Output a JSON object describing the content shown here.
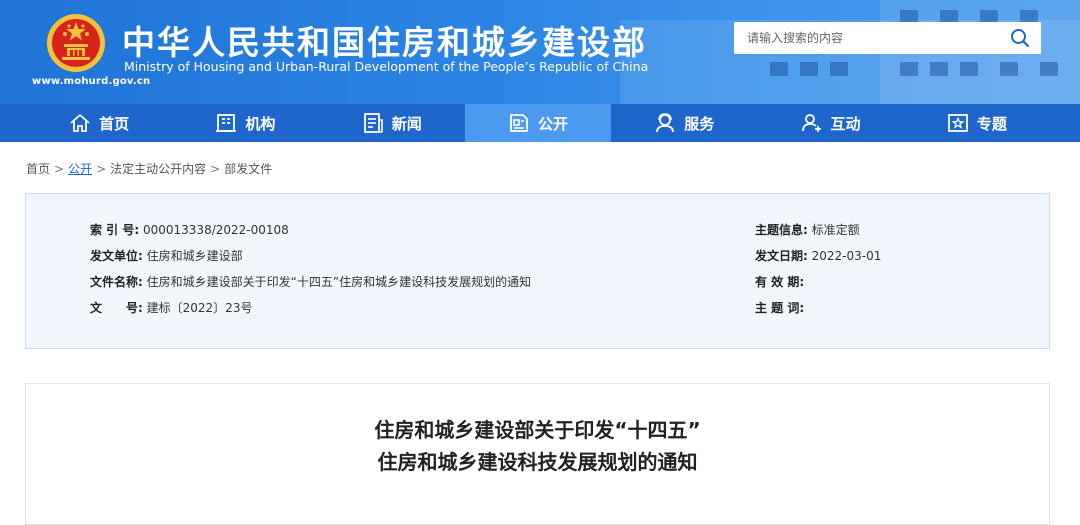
{
  "header": {
    "title": "中华人民共和国住房和城乡建设部",
    "subtitle": "Ministry of Housing and Urban-Rural Development of the People’s Republic of China",
    "domain": "www.mohurd.gov.cn",
    "emblem_icon": "national-emblem-icon"
  },
  "search": {
    "placeholder": "请输入搜索的内容",
    "icon": "search-icon"
  },
  "nav": {
    "items": [
      {
        "label": "首页",
        "icon": "home-icon"
      },
      {
        "label": "机构",
        "icon": "building-icon"
      },
      {
        "label": "新闻",
        "icon": "newspaper-icon"
      },
      {
        "label": "公开",
        "icon": "public-info-icon"
      },
      {
        "label": "服务",
        "icon": "service-icon"
      },
      {
        "label": "互动",
        "icon": "interaction-icon"
      },
      {
        "label": "专题",
        "icon": "topic-icon"
      }
    ],
    "active": "公开"
  },
  "breadcrumb": {
    "home": "首页",
    "public": "公开",
    "section": "法定主动公开内容",
    "current": "部发文件",
    "separator": ">"
  },
  "meta": {
    "index_label": "索 引 号:",
    "index_value": "000013338/2022-00108",
    "issuer_label": "发文单位:",
    "issuer_value": "住房和城乡建设部",
    "docname_label": "文件名称:",
    "docname_value": "住房和城乡建设部关于印发“十四五”住房和城乡建设科技发展规划的通知",
    "docno_label": "文　　号:",
    "docno_value": "建标〔2022〕23号",
    "topic_label": "主题信息:",
    "topic_value": "标准定额",
    "date_label": "发文日期:",
    "date_value": "2022-03-01",
    "validity_label": "有 效 期:",
    "validity_value": "",
    "keywords_label": "主 题 词:",
    "keywords_value": ""
  },
  "article": {
    "title_line1": "住房和城乡建设部关于印发“十四五”",
    "title_line2": "住房和城乡建设科技发展规划的通知"
  },
  "colors": {
    "header_blue": "#2b84e4",
    "nav_blue": "#1f66cc",
    "nav_active": "#4b9af0",
    "panel_bg": "#f1f6fd",
    "emblem_red": "#d6241c",
    "emblem_gold": "#f2c23a"
  }
}
